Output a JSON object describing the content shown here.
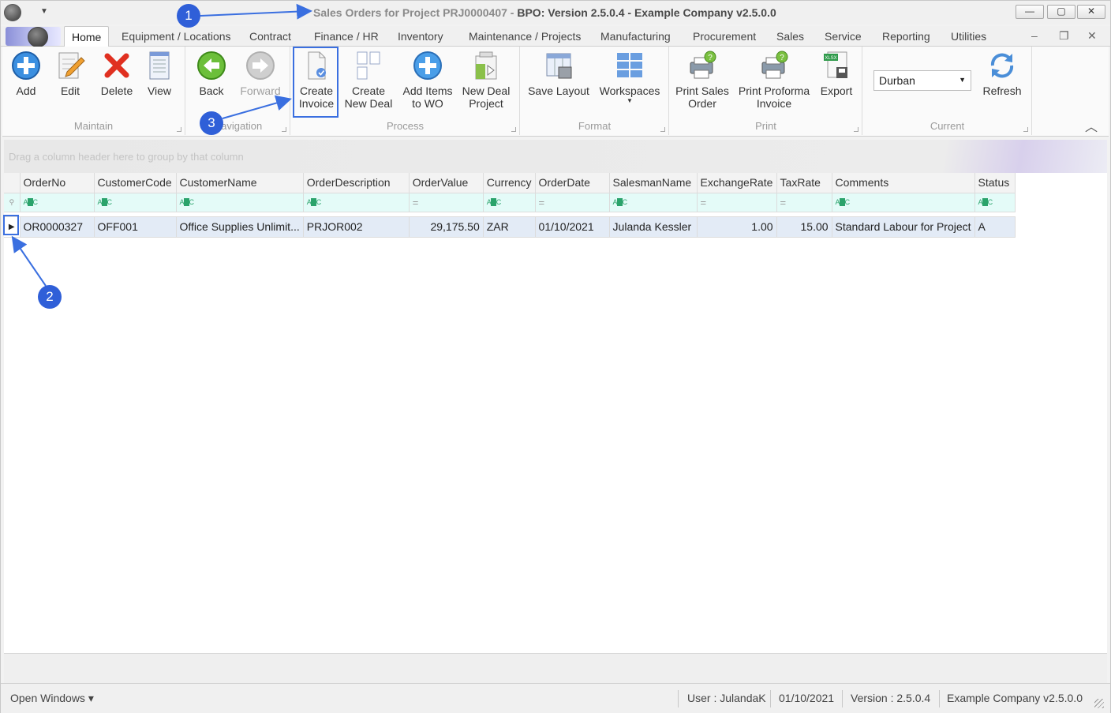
{
  "window": {
    "title_prefix": "Sales Orders for Project PRJ0000407 - ",
    "title_main": "BPO: Version 2.5.0.4 - Example Company v2.5.0.0",
    "minimize": "—",
    "maximize": "▢",
    "close": "✕"
  },
  "tabs": [
    "Home",
    "Equipment / Locations",
    "Contract",
    "Finance / HR",
    "Inventory",
    "Maintenance / Projects",
    "Manufacturing",
    "Procurement",
    "Sales",
    "Service",
    "Reporting",
    "Utilities"
  ],
  "ribbon": {
    "maintain": {
      "label": "Maintain",
      "add": "Add",
      "edit": "Edit",
      "delete": "Delete",
      "view": "View"
    },
    "navigation": {
      "label": "Navigation",
      "back": "Back",
      "forward": "Forward"
    },
    "process": {
      "label": "Process",
      "create_invoice_1": "Create",
      "create_invoice_2": "Invoice",
      "create_new_deal_1": "Create",
      "create_new_deal_2": "New Deal",
      "add_items_1": "Add Items",
      "add_items_2": "to WO",
      "new_deal_project_1": "New Deal",
      "new_deal_project_2": "Project"
    },
    "format": {
      "label": "Format",
      "save_layout": "Save Layout",
      "workspaces": "Workspaces"
    },
    "print": {
      "label": "Print",
      "print_sales_order_1": "Print Sales",
      "print_sales_order_2": "Order",
      "print_proforma_1": "Print Proforma",
      "print_proforma_2": "Invoice",
      "export": "Export"
    },
    "current": {
      "label": "Current",
      "site_value": "Durban",
      "refresh": "Refresh"
    }
  },
  "group_panel_hint": "Drag a column header here to group by that column",
  "grid": {
    "columns": [
      "OrderNo",
      "CustomerCode",
      "CustomerName",
      "OrderDescription",
      "OrderValue",
      "Currency",
      "OrderDate",
      "SalesmanName",
      "ExchangeRate",
      "TaxRate",
      "Comments",
      "Status"
    ],
    "rows": [
      [
        "OR0000327",
        "OFF001",
        "Office Supplies Unlimit...",
        "PRJOR002",
        "29,175.50",
        "ZAR",
        "01/10/2021",
        "Julanda Kessler",
        "1.00",
        "15.00",
        "Standard Labour for Project",
        "A"
      ]
    ]
  },
  "statusbar": {
    "open_windows": "Open Windows ▾",
    "user": "User : JulandaK",
    "date": "01/10/2021",
    "version": "Version : 2.5.0.4",
    "company": "Example Company v2.5.0.0"
  },
  "annotations": [
    "1",
    "2",
    "3"
  ],
  "colors": {
    "accent": "#2f5fd8",
    "selected_row": "#e3ebf6",
    "filter_row": "#e4fbf8"
  }
}
